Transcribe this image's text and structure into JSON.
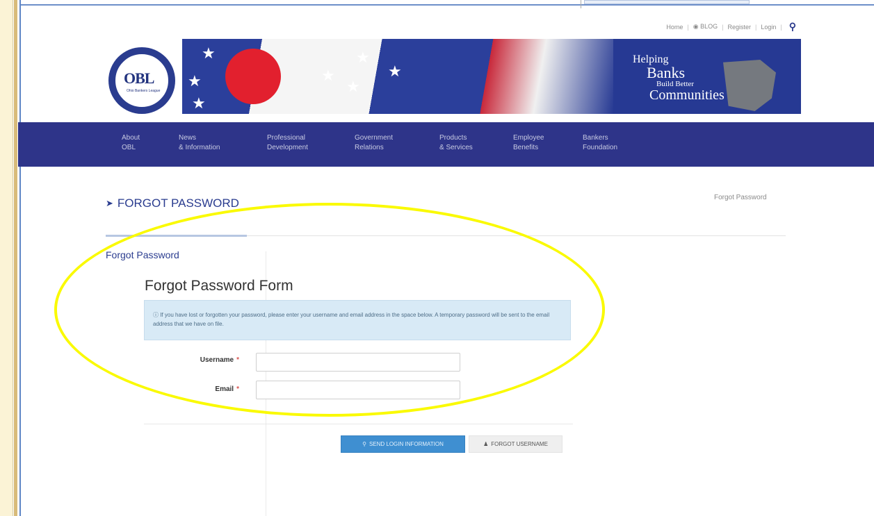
{
  "top_links": {
    "home": "Home",
    "blog": "BLOG",
    "register": "Register",
    "login": "Login",
    "separator": "|"
  },
  "icons": {
    "search": "search-icon",
    "paper_plane": "paper-plane-icon",
    "info": "info-icon",
    "key": "key-icon",
    "user": "user-icon"
  },
  "banner": {
    "logo_text": "OBL",
    "logo_subtext": "Ohio Bankers League",
    "tagline": [
      "Helping",
      "Banks",
      "Build Better",
      "Communities"
    ]
  },
  "nav": [
    {
      "line1": "About",
      "line2": "OBL"
    },
    {
      "line1": "News",
      "line2": "& Information"
    },
    {
      "line1": "Professional",
      "line2": "Development"
    },
    {
      "line1": "Government",
      "line2": "Relations"
    },
    {
      "line1": "Products",
      "line2": "& Services"
    },
    {
      "line1": "Employee",
      "line2": "Benefits"
    },
    {
      "line1": "Bankers",
      "line2": "Foundation"
    }
  ],
  "page": {
    "title": "FORGOT PASSWORD",
    "breadcrumb": "Forgot Password",
    "side_label": "Forgot Password"
  },
  "form": {
    "heading": "Forgot Password Form",
    "alert_line1": "If you have lost or forgotten your password, please enter your username and email address in the space below. A temporary password will be sent to the email address that we have on file.",
    "username_label": "Username",
    "email_label": "Email",
    "required_mark": "*",
    "username_value": "",
    "email_value": "",
    "send_button": "SEND LOGIN INFORMATION",
    "forgot_username_button": "FORGOT USERNAME"
  },
  "colors": {
    "brand_navy": "#2e3489",
    "title_blue": "#2a3c8f",
    "primary_button": "#3f8fd1",
    "alert_bg": "#d8eaf6",
    "highlight": "#fafa00"
  }
}
